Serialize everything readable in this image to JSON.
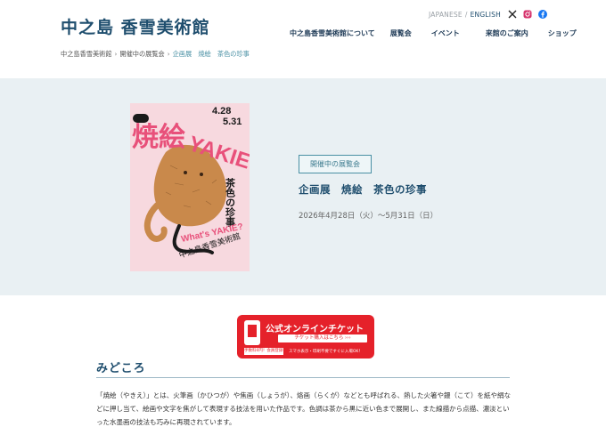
{
  "header": {
    "logo": "中之島 香雪美術館",
    "lang_ja": "JAPANESE",
    "lang_sep": "/",
    "lang_en": "ENGLISH",
    "social": [
      "x-icon",
      "instagram-icon",
      "facebook-icon"
    ],
    "nav": [
      "中之島香雪美術館について",
      "展覧会",
      "イベント",
      "来館のご案内",
      "ショップ"
    ]
  },
  "breadcrumb": {
    "items": [
      "中之島香雪美術館",
      "開催中の展覧会"
    ],
    "sep": "›",
    "current": "企画展　焼絵　茶色の珍事"
  },
  "hero": {
    "poster": {
      "title": "焼絵",
      "title_en": "YAKIE",
      "sub": "茶色の珍事",
      "date_start": "4.28",
      "date_end": "5.31",
      "question": "What's YAKIE?",
      "museum": "中之島香雪美術館"
    },
    "badge": "開催中の展覧会",
    "title": "企画展　焼絵　茶色の珍事",
    "date": "2026年4月28日（火）〜5月31日（日）"
  },
  "ticket": {
    "title": "公式オンラインチケット",
    "sub": "チケット購入はこちら ›››",
    "fee": "手数料0円！会員登録不要！",
    "note": "スマホ表示・印刷不要ですぐに入場OK！"
  },
  "section": {
    "title": "みどころ",
    "body": "「焼絵（やきえ）」とは、火筆画（かひつが）や焦画（しょうが）、烙画（らくが）などとも呼ばれる、熱した火箸や鏝（こて）を紙や絹などに押し当て、絵画や文字を焦がして表現する技法を用いた作品です。色調は茶から黒に近い色まで展開し、また線描から点描、濃淡といった水墨画の技法も巧みに再現されています。"
  },
  "colors": {
    "brand": "#1f4e6e",
    "accent": "#4a90a4",
    "hero_bg": "#e9f0f3",
    "ticket_red": "#e5212a",
    "poster_pink": "#e8507a"
  }
}
